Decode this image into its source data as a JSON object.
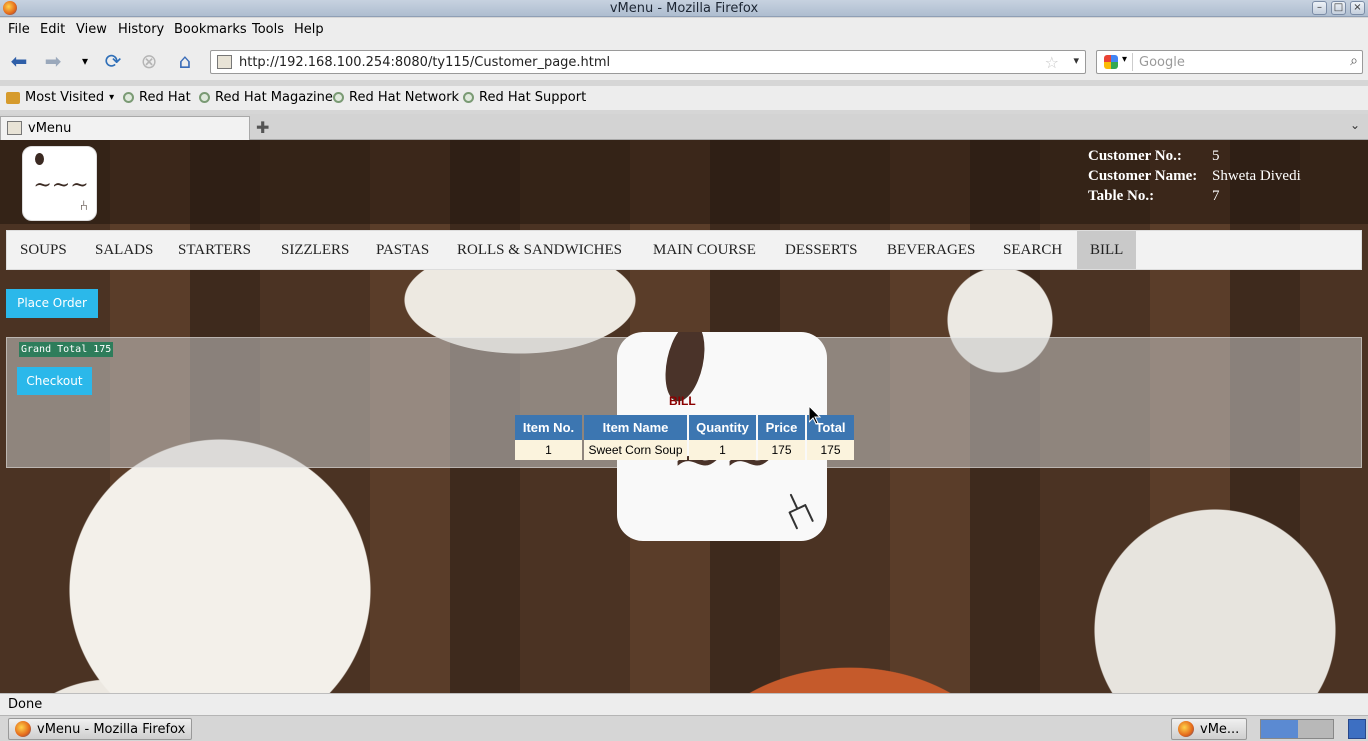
{
  "window": {
    "title": "vMenu - Mozilla Firefox"
  },
  "menubar": {
    "items": [
      "File",
      "Edit",
      "View",
      "History",
      "Bookmarks",
      "Tools",
      "Help"
    ]
  },
  "navbar": {
    "url": "http://192.168.100.254:8080/ty115/Customer_page.html",
    "search_placeholder": "Google"
  },
  "bookmarks": {
    "most_visited": "Most Visited",
    "items": [
      "Red Hat",
      "Red Hat Magazine",
      "Red Hat Network",
      "Red Hat Support"
    ]
  },
  "tabs": {
    "active_label": "vMenu"
  },
  "page": {
    "customer": {
      "no_label": "Customer No.:",
      "no_value": "5",
      "name_label": "Customer Name:",
      "name_value": "Shweta Divedi",
      "table_label": "Table No.:",
      "table_value": "7"
    },
    "menu": [
      "SOUPS",
      "SALADS",
      "STARTERS",
      "SIZZLERS",
      "PASTAS",
      "ROLLS & SANDWICHES",
      "MAIN COURSE",
      "DESSERTS",
      "BEVERAGES",
      "SEARCH",
      "BILL"
    ],
    "place_order_label": "Place Order",
    "grand_total_label": "Grand Total",
    "grand_total_value": "175",
    "checkout_label": "Checkout",
    "bill": {
      "title": "BILL",
      "headers": [
        "Item No.",
        "Item Name",
        "Quantity",
        "Price",
        "Total"
      ],
      "rows": [
        [
          "1",
          "Sweet Corn Soup",
          "1",
          "175",
          "175"
        ]
      ]
    }
  },
  "status": {
    "text": "Done"
  },
  "taskbar": {
    "task1": "vMenu - Mozilla Firefox",
    "task2": "vMe..."
  }
}
